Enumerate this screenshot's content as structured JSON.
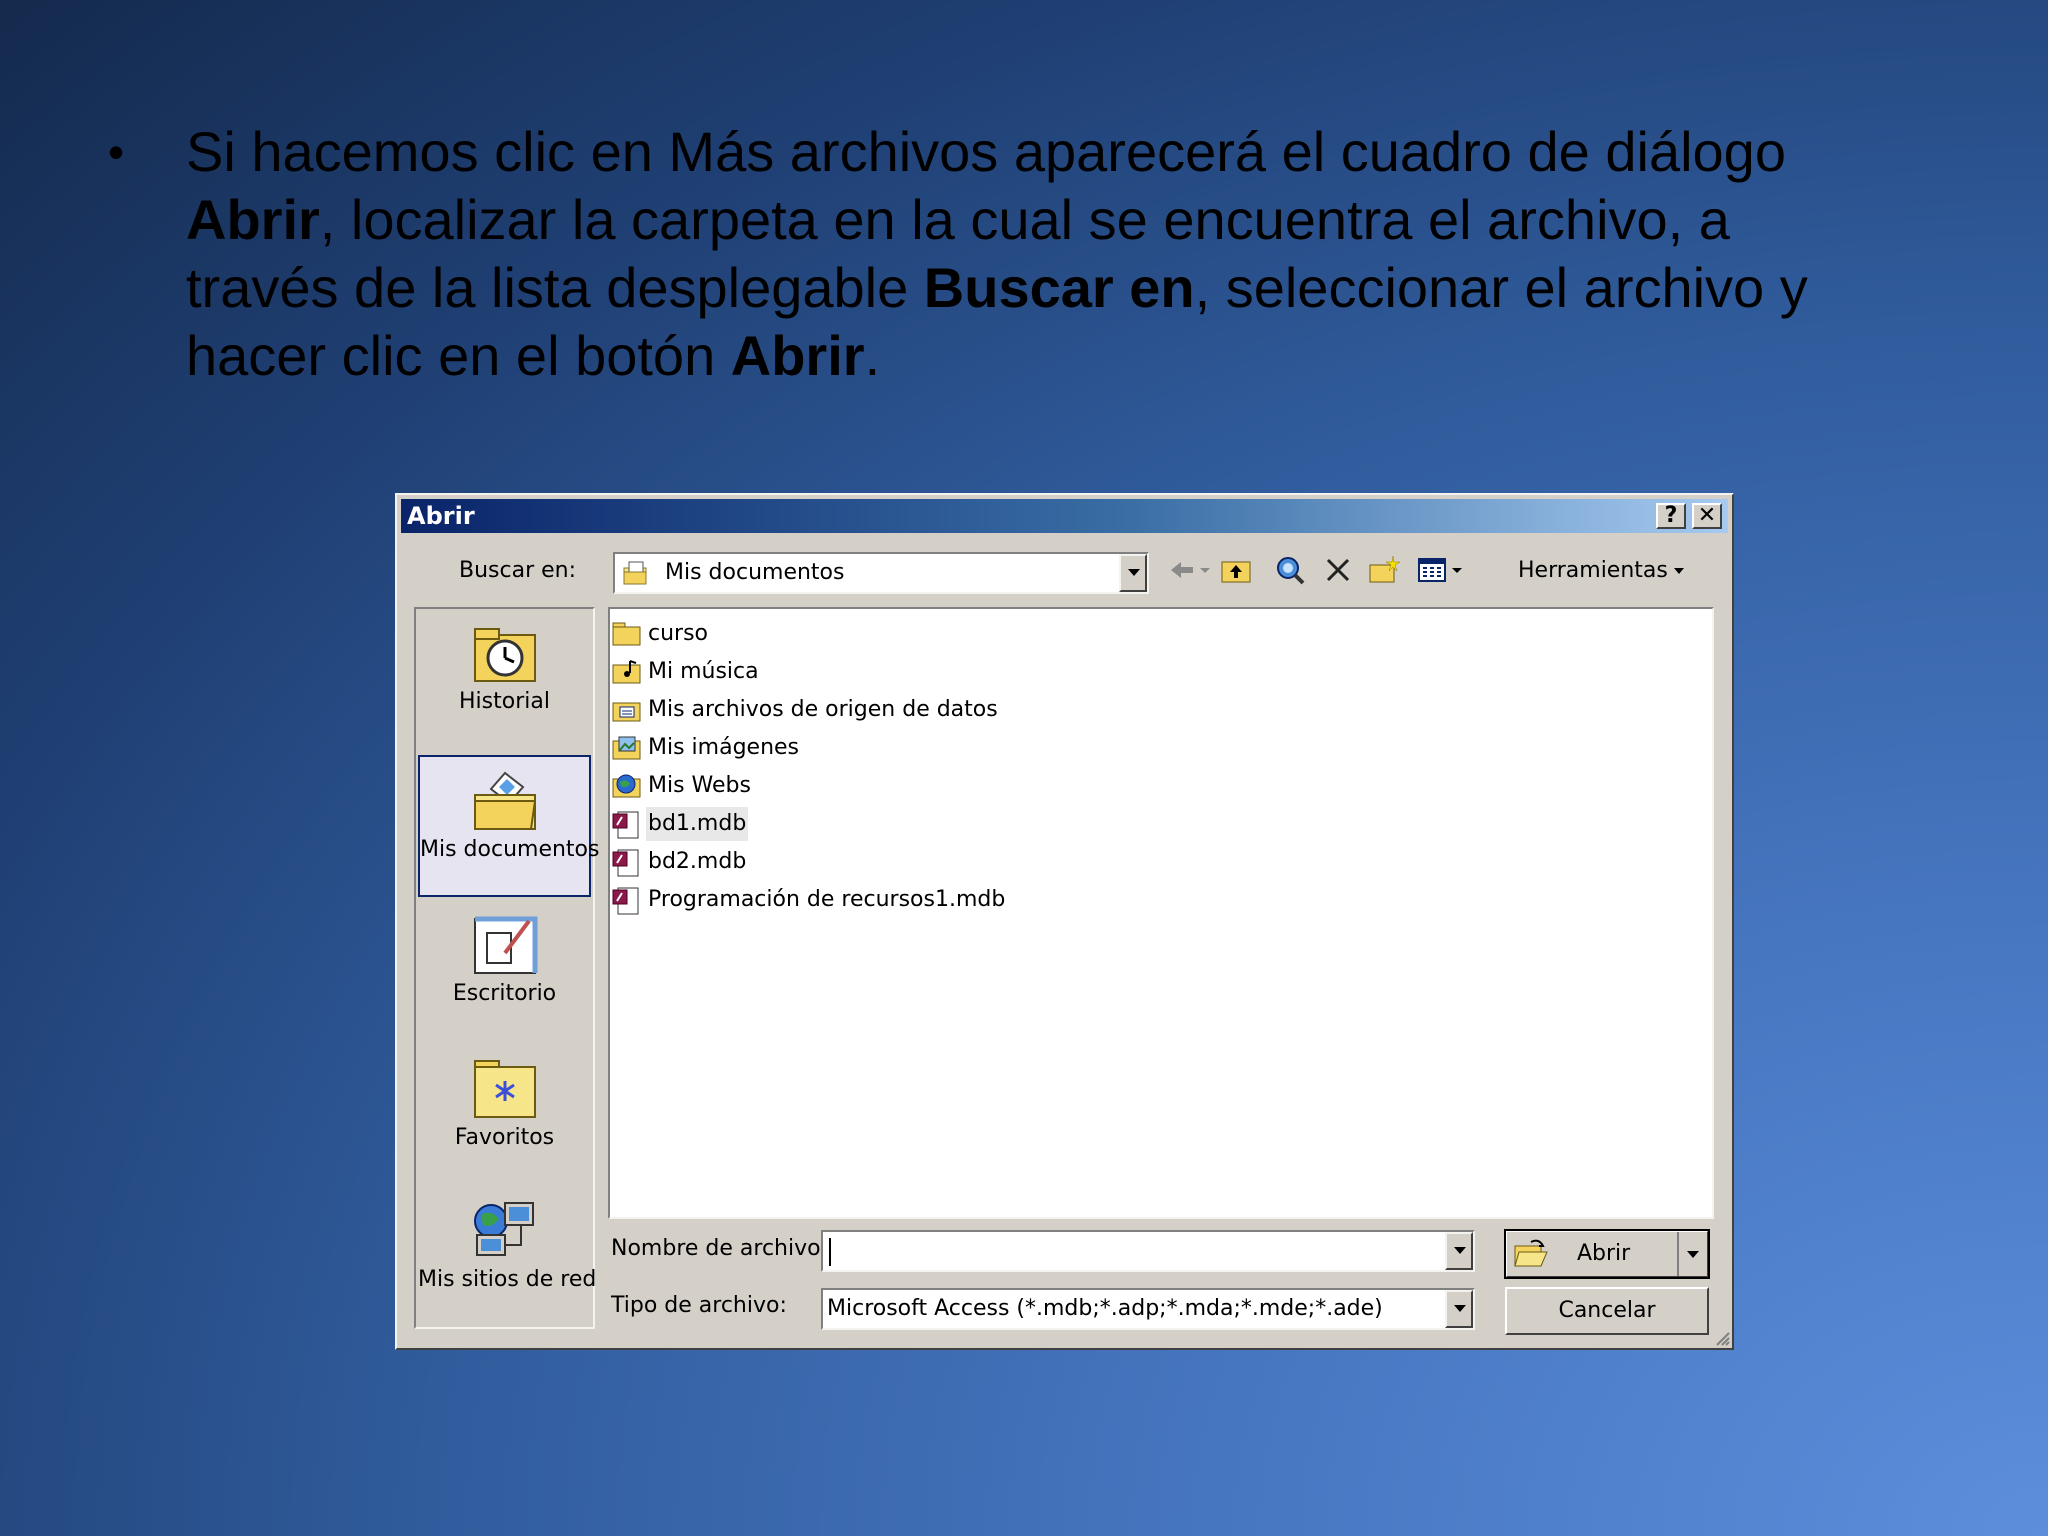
{
  "slide": {
    "bullet": "•",
    "p1": "Si hacemos clic en Más archivos aparecerá el cuadro de diálogo ",
    "b1": "Abrir",
    "p2": ", localizar la carpeta en la cual se encuentra el archivo, a través de la lista desplegable ",
    "b2": "Buscar en",
    "p3": ", seleccionar el archivo y hacer clic en el botón ",
    "b3": "Abrir",
    "p4": "."
  },
  "dialog": {
    "title": "Abrir",
    "help_glyph": "?",
    "close_glyph": "✕",
    "lookin_label": "Buscar en:",
    "lookin_value": "Mis documentos",
    "tools_label": "Herramientas",
    "places": [
      {
        "label": "Historial",
        "icon": "history-icon"
      },
      {
        "label": "Mis documentos",
        "icon": "my-documents-icon"
      },
      {
        "label": "Escritorio",
        "icon": "desktop-icon"
      },
      {
        "label": "Favoritos",
        "icon": "favorites-icon"
      },
      {
        "label": "Mis sitios de red",
        "icon": "network-places-icon"
      }
    ],
    "files": [
      {
        "name": "curso",
        "icon": "folder-icon"
      },
      {
        "name": "Mi música",
        "icon": "music-folder-icon"
      },
      {
        "name": "Mis archivos de origen de datos",
        "icon": "data-sources-folder-icon"
      },
      {
        "name": "Mis imágenes",
        "icon": "pictures-folder-icon"
      },
      {
        "name": "Mis Webs",
        "icon": "webs-folder-icon"
      },
      {
        "name": "bd1.mdb",
        "icon": "access-db-icon"
      },
      {
        "name": "bd2.mdb",
        "icon": "access-db-icon"
      },
      {
        "name": "Programación de recursos1.mdb",
        "icon": "access-db-icon"
      }
    ],
    "filename_label": "Nombre de archivo:",
    "filename_value": "",
    "filetype_label": "Tipo de archivo:",
    "filetype_value": "Microsoft Access (*.mdb;*.adp;*.mda;*.mde;*.ade)",
    "open_button": "Abrir",
    "cancel_button": "Cancelar"
  },
  "colors": {
    "title_start": "#0a246a",
    "title_end": "#a6caf0",
    "face": "#d4d0c8"
  }
}
